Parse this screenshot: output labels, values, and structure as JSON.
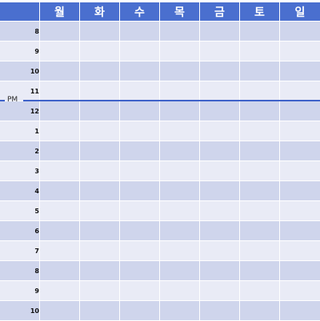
{
  "calendar": {
    "days": [
      "월",
      "화",
      "수",
      "목",
      "금",
      "토",
      "일"
    ],
    "hours": [
      "8",
      "9",
      "10",
      "11",
      "12",
      "1",
      "2",
      "3",
      "4",
      "5",
      "6",
      "7",
      "8",
      "9",
      "10"
    ],
    "pm_label": "PM"
  },
  "colors": {
    "header_bg": "#4a6fcf",
    "row_dark": "#cfd5ec",
    "row_light": "#e9ebf6",
    "pm_line": "#3e62c9"
  }
}
